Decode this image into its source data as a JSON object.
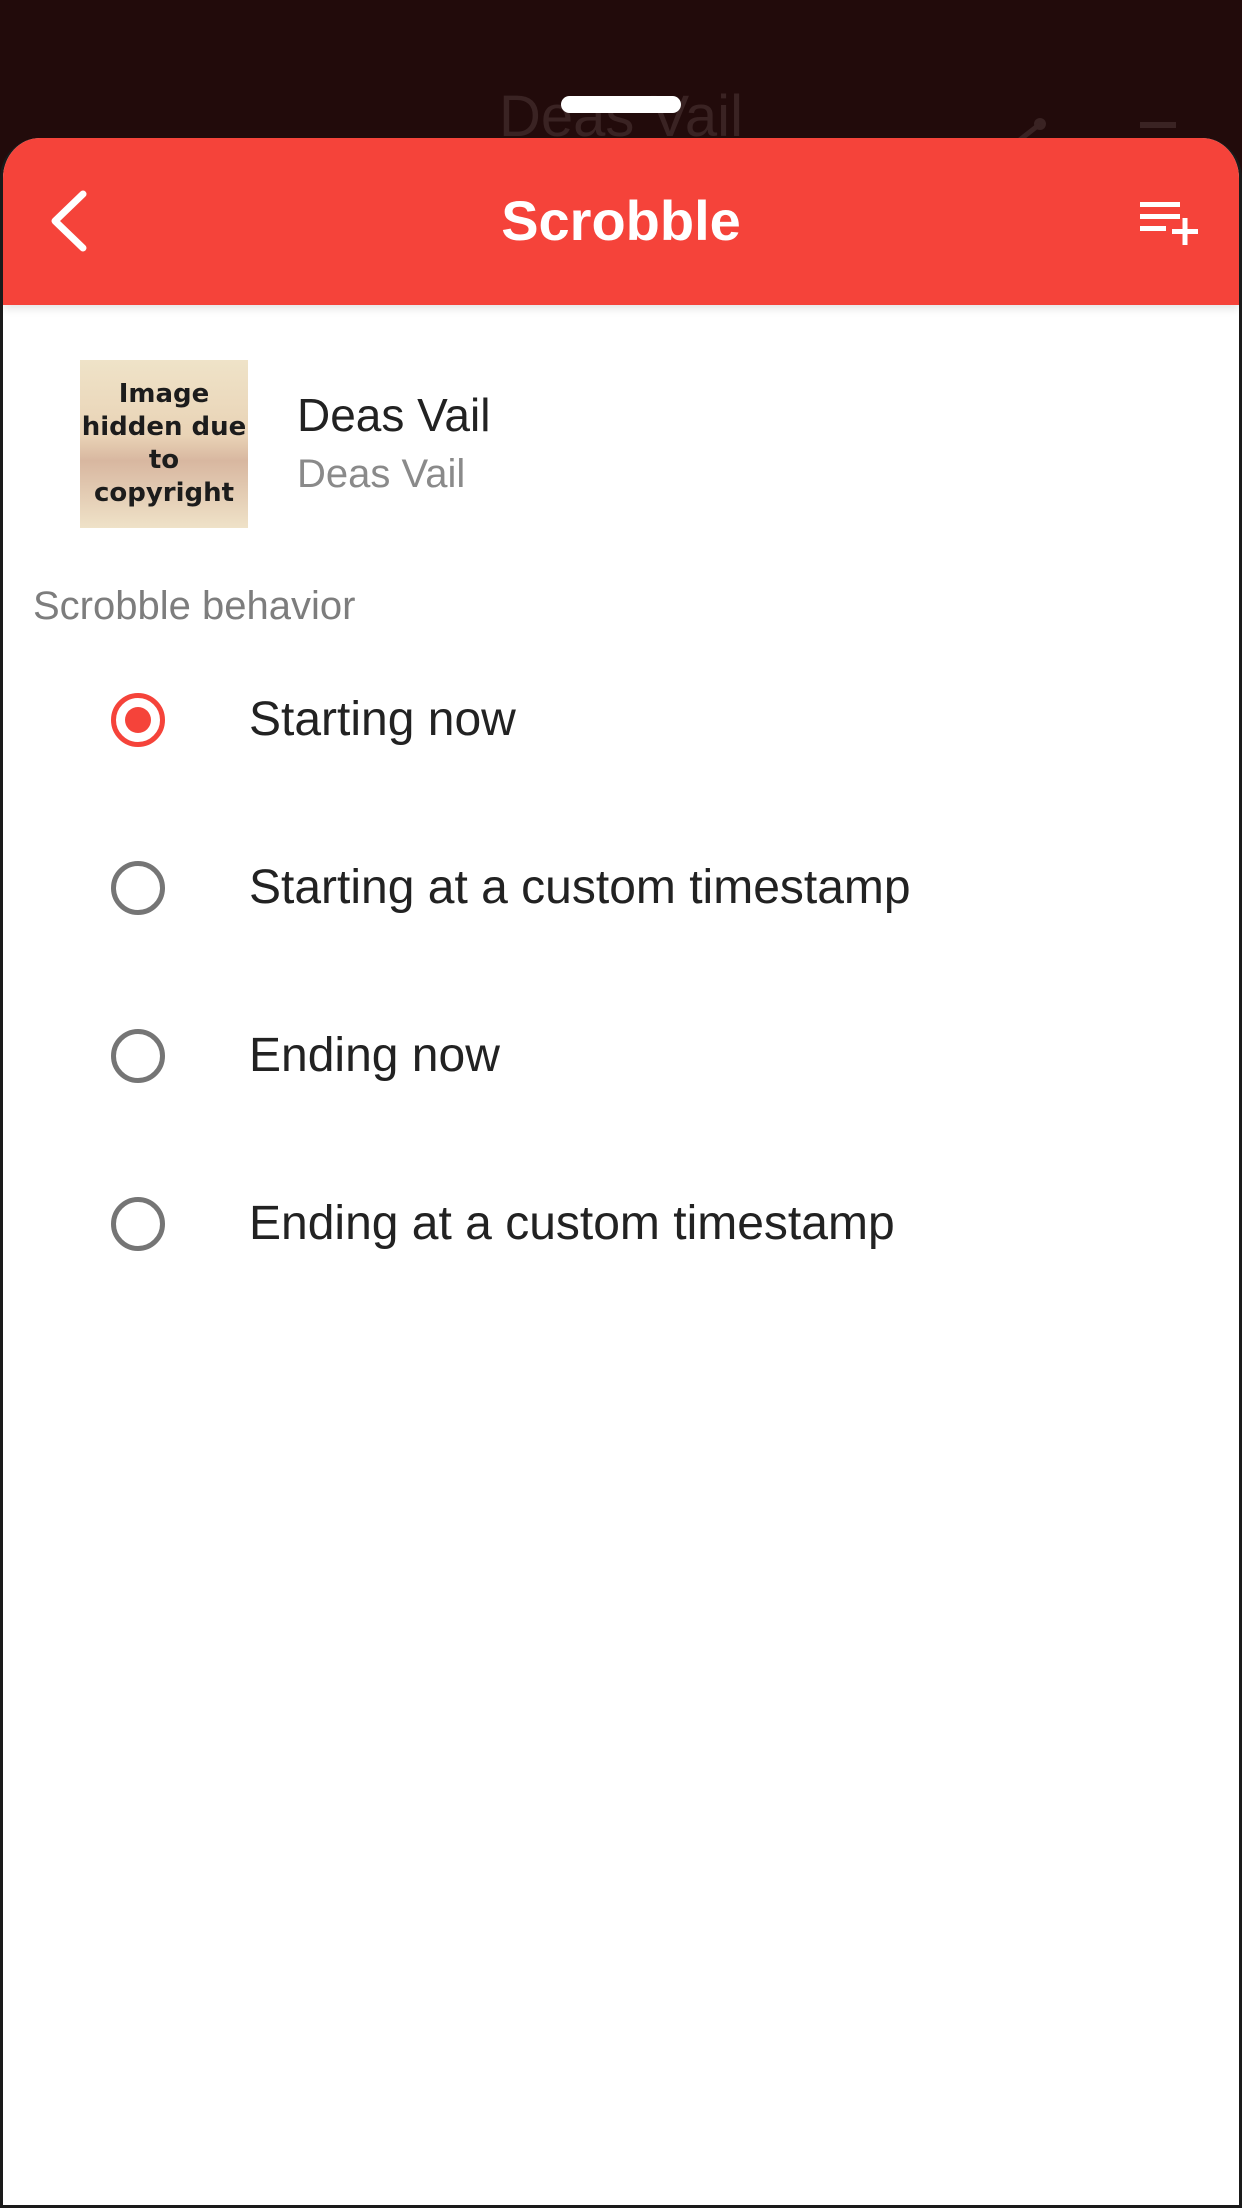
{
  "backdrop": {
    "title": "Deas Vail"
  },
  "navbar": {
    "title": "Scrobble",
    "accent_color": "#f5433a",
    "back_icon": "chevron-left-icon",
    "queue_icon": "playlist-add-icon"
  },
  "track": {
    "artwork_text": "Image hidden due to copyright",
    "title": "Deas Vail",
    "artist": "Deas Vail"
  },
  "scrobble_behavior": {
    "header": "Scrobble behavior",
    "selected_index": 0,
    "options": [
      {
        "label": "Starting now",
        "checked": true
      },
      {
        "label": "Starting at a custom timestamp",
        "checked": false
      },
      {
        "label": "Ending now",
        "checked": false
      },
      {
        "label": "Ending at a custom timestamp",
        "checked": false
      }
    ]
  }
}
